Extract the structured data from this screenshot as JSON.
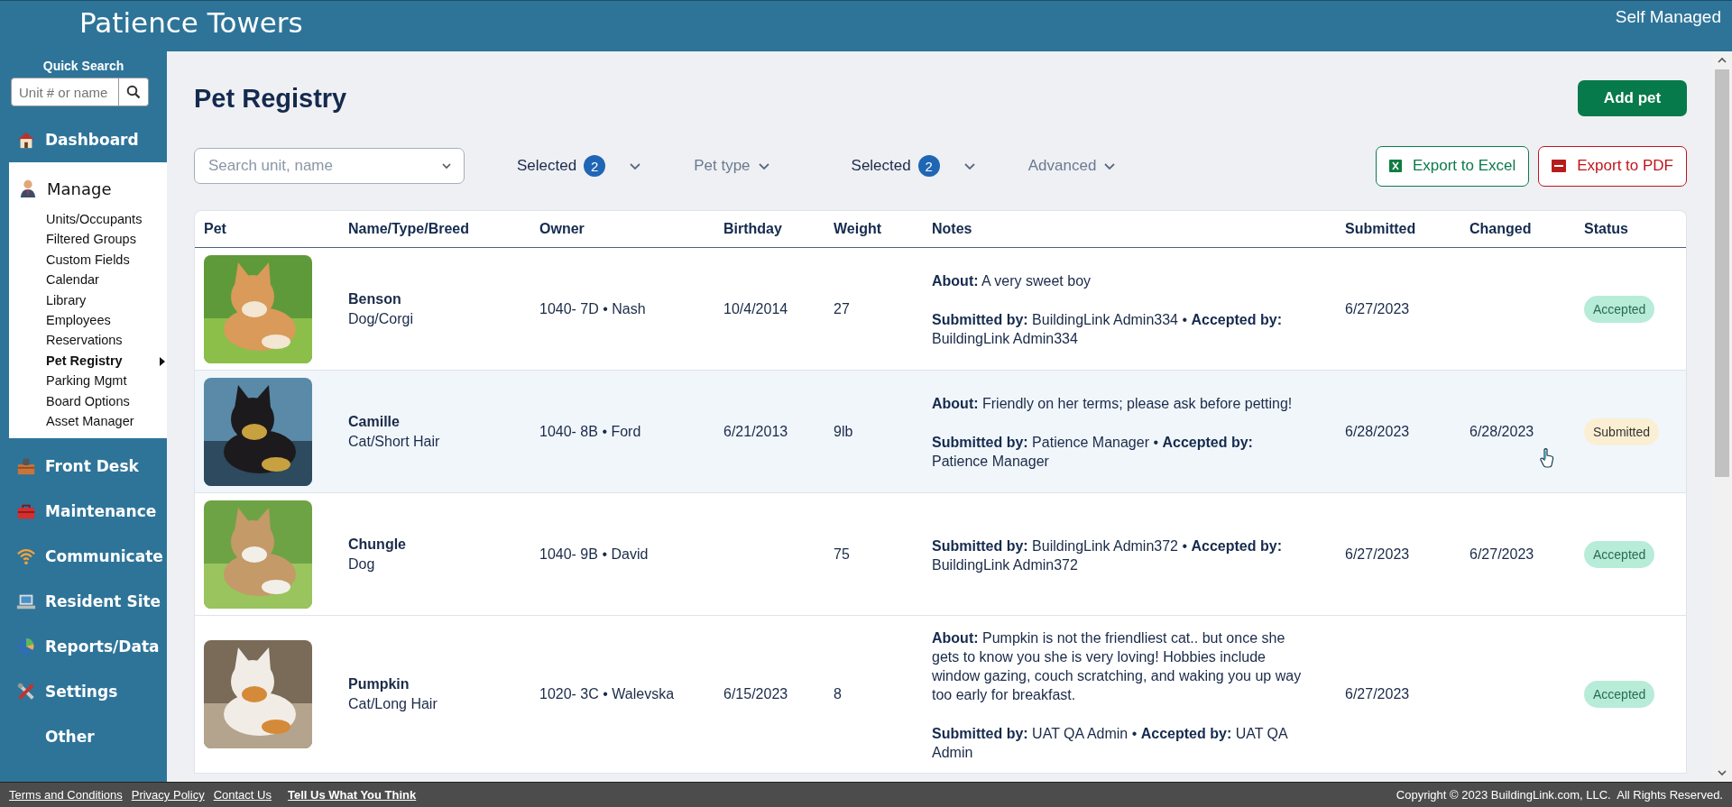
{
  "header": {
    "title": "Patience Towers",
    "mode": "Self Managed"
  },
  "sidebar": {
    "quick_search": {
      "label": "Quick Search",
      "placeholder": "Unit # or name"
    },
    "items": [
      {
        "label": "Dashboard",
        "expanded": false
      },
      {
        "label": "Manage",
        "expanded": true,
        "children": [
          {
            "label": "Units/Occupants",
            "selected": false
          },
          {
            "label": "Filtered Groups",
            "selected": false
          },
          {
            "label": "Custom Fields",
            "selected": false
          },
          {
            "label": "Calendar",
            "selected": false
          },
          {
            "label": "Library",
            "selected": false
          },
          {
            "label": "Employees",
            "selected": false
          },
          {
            "label": "Reservations",
            "selected": false
          },
          {
            "label": "Pet Registry",
            "selected": true
          },
          {
            "label": "Parking Mgmt",
            "selected": false
          },
          {
            "label": "Board Options",
            "selected": false
          },
          {
            "label": "Asset Manager",
            "selected": false
          }
        ]
      },
      {
        "label": "Front Desk",
        "expanded": false
      },
      {
        "label": "Maintenance",
        "expanded": false
      },
      {
        "label": "Communicate",
        "expanded": false
      },
      {
        "label": "Resident Site",
        "expanded": false
      },
      {
        "label": "Reports/Data",
        "expanded": false
      },
      {
        "label": "Settings",
        "expanded": false
      },
      {
        "label": "Other",
        "expanded": false
      }
    ]
  },
  "page": {
    "title": "Pet Registry",
    "add_button": "Add pet",
    "search": {
      "placeholder": "Search unit, name"
    },
    "filters": [
      {
        "label": "Selected",
        "count": "2"
      },
      {
        "label": "Pet type"
      },
      {
        "label": "Selected",
        "count": "2"
      },
      {
        "label": "Advanced"
      }
    ],
    "exports": [
      {
        "label": "Export to Excel",
        "kind": "excel"
      },
      {
        "label": "Export to PDF",
        "kind": "pdf"
      }
    ]
  },
  "table": {
    "columns": [
      "Pet",
      "Name/Type/Breed",
      "Owner",
      "Birthday",
      "Weight",
      "Notes",
      "Submitted",
      "Changed",
      "Status"
    ],
    "rows": [
      {
        "name": "Benson",
        "type": "Dog/Corgi",
        "owner": "1040- 7D • Nash",
        "birthday": "10/4/2014",
        "weight": "27",
        "notes": [
          "**About:** A very sweet boy",
          "**Submitted by:** BuildingLink Admin334 • **Accepted by:** BuildingLink Admin334"
        ],
        "submitted": "6/27/2023",
        "status": {
          "label": "Accepted",
          "kind": "accepted"
        },
        "hovered": false
      },
      {
        "name": "Camille",
        "type": "Cat/Short Hair",
        "owner": "1040- 8B • Ford",
        "birthday": "6/21/2013",
        "weight": "9lb",
        "notes": [
          "**About:** Friendly on her terms; please ask before petting!",
          "**Submitted by:** Patience Manager • **Accepted by:** Patience Manager"
        ],
        "submitted": "6/28/2023",
        "changed": "6/28/2023",
        "status": {
          "label": "Submitted",
          "kind": "submitted"
        },
        "hovered": true
      },
      {
        "name": "Chungle",
        "type": "Dog",
        "owner": "1040- 9B • David",
        "weight": "75",
        "notes": [
          "**Submitted by:** BuildingLink Admin372 • **Accepted by:** BuildingLink Admin372"
        ],
        "submitted": "6/27/2023",
        "changed": "6/27/2023",
        "status": {
          "label": "Accepted",
          "kind": "accepted"
        },
        "hovered": false
      },
      {
        "name": "Pumpkin",
        "type": "Cat/Long Hair",
        "owner": "1020- 3C • Walevska",
        "birthday": "6/15/2023",
        "weight": "8",
        "notes": [
          "**About:** Pumpkin is not the friendliest cat.. but once she gets to know you she is very loving! Hobbies include window gazing, couch scratching, and waking you up way too early for breakfast.",
          "**Submitted by:** UAT QA Admin • **Accepted by:** UAT QA Admin"
        ],
        "submitted": "6/27/2023",
        "status": {
          "label": "Accepted",
          "kind": "accepted"
        },
        "hovered": false
      }
    ]
  },
  "footer": {
    "links": [
      "Terms and Conditions",
      "Privacy Policy",
      "Contact Us"
    ],
    "feedback": "Tell Us What You Think",
    "copyright": "Copyright © 2023 BuildingLink.com, LLC.  All Rights Reserved."
  }
}
